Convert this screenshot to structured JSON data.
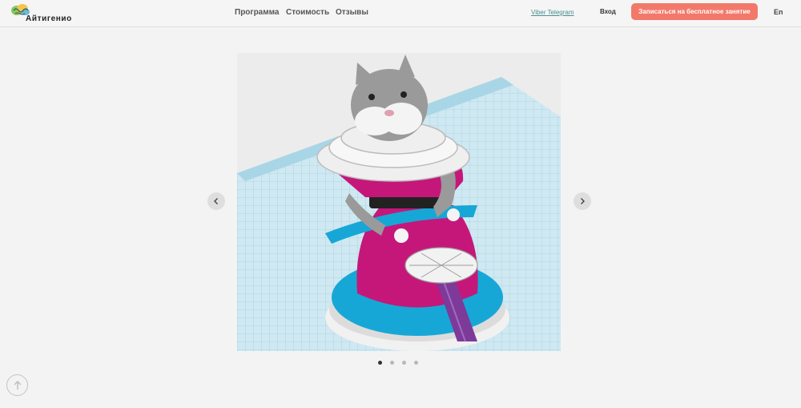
{
  "brand": {
    "name": "Айтигенио"
  },
  "header": {
    "ghost_text": "",
    "nav": [
      "Программа",
      "Стоимость",
      "Отзывы"
    ],
    "viber": "Viber",
    "telegram": "Telegram",
    "login": "Вход",
    "cta": "Записаться на бесплатное занятие",
    "lang": "En"
  },
  "slider": {
    "slide_count": 4,
    "active_index": 0,
    "image": "3d-cat-figure-in-pink-dress-on-grid"
  },
  "icons": {
    "prev": "chevron-left-icon",
    "next": "chevron-right-icon",
    "scroll_top": "arrow-up-icon"
  },
  "colors": {
    "accent": "#f2796a",
    "link": "#4a8f8c",
    "background": "#f3f3f3"
  }
}
